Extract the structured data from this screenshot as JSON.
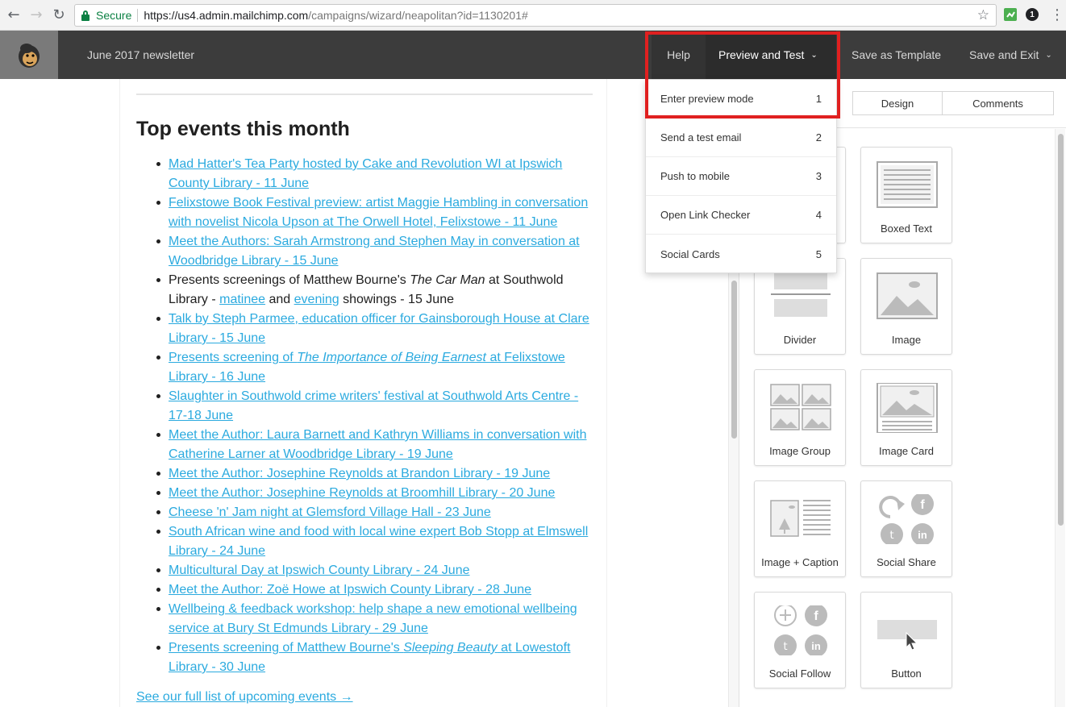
{
  "browser": {
    "secure_label": "Secure",
    "url_host": "https://us4.admin.mailchimp.com",
    "url_path": "/campaigns/wizard/neapolitan?id=1130201#",
    "extension_badge": "1"
  },
  "header": {
    "campaign_title": "June 2017 newsletter",
    "help_label": "Help",
    "preview_label": "Preview and Test",
    "save_template_label": "Save as Template",
    "save_exit_label": "Save and Exit"
  },
  "preview_menu": {
    "items": [
      {
        "label": "Enter preview mode",
        "shortcut": "1"
      },
      {
        "label": "Send a test email",
        "shortcut": "2"
      },
      {
        "label": "Push to mobile",
        "shortcut": "3"
      },
      {
        "label": "Open Link Checker",
        "shortcut": "4"
      },
      {
        "label": "Social Cards",
        "shortcut": "5"
      }
    ]
  },
  "email": {
    "heading": "Top events this month",
    "events": [
      {
        "parts": [
          {
            "t": "Mad Hatter's Tea Party hosted by Cake and Revolution WI at Ipswich County Library - 11 June",
            "link": true
          }
        ]
      },
      {
        "parts": [
          {
            "t": "Felixstowe Book Festival preview: artist Maggie Hambling in conversation with novelist Nicola Upson at The Orwell Hotel, Felixstowe - 11 June",
            "link": true
          }
        ]
      },
      {
        "parts": [
          {
            "t": "Meet the Authors: Sarah Armstrong and Stephen May in conversation at Woodbridge Library - 15 June",
            "link": true
          }
        ]
      },
      {
        "parts": [
          {
            "t": "Presents screenings of Matthew Bourne's "
          },
          {
            "t": "The Car Man",
            "italic": true
          },
          {
            "t": " at Southwold Library - "
          },
          {
            "t": "matinee",
            "link": true
          },
          {
            "t": " and "
          },
          {
            "t": "evening",
            "link": true
          },
          {
            "t": " showings - 15 June"
          }
        ]
      },
      {
        "parts": [
          {
            "t": "Talk by Steph Parmee, education officer for Gainsborough House at Clare Library - 15 June",
            "link": true
          }
        ]
      },
      {
        "parts": [
          {
            "t": "Presents screening of ",
            "link": true
          },
          {
            "t": "The Importance of Being Earnest",
            "link": true,
            "italic": true
          },
          {
            "t": " at Felixstowe Library - 16 June",
            "link": true
          }
        ]
      },
      {
        "parts": [
          {
            "t": "Slaughter in Southwold crime writers' festival at Southwold Arts Centre - 17-18 June",
            "link": true
          }
        ]
      },
      {
        "parts": [
          {
            "t": "Meet the Author: Laura Barnett and Kathryn Williams in conversation with Catherine Larner at Woodbridge Library - 19 June",
            "link": true
          }
        ]
      },
      {
        "parts": [
          {
            "t": "Meet the Author: Josephine Reynolds at Brandon Library - 19 June",
            "link": true
          }
        ]
      },
      {
        "parts": [
          {
            "t": "Meet the Author: Josephine Reynolds at Broomhill Library - 20 June",
            "link": true
          }
        ]
      },
      {
        "parts": [
          {
            "t": "Cheese 'n' Jam night at Glemsford Village Hall - 23 June",
            "link": true
          }
        ]
      },
      {
        "parts": [
          {
            "t": "South African wine and food with local wine expert Bob Stopp at Elmswell Library - 24 June",
            "link": true
          }
        ]
      },
      {
        "parts": [
          {
            "t": "Multicultural Day at Ipswich County Library - 24 June",
            "link": true
          }
        ]
      },
      {
        "parts": [
          {
            "t": "Meet the Author: Zoë Howe at Ipswich County Library - 28 June",
            "link": true
          }
        ]
      },
      {
        "parts": [
          {
            "t": "Wellbeing & feedback workshop: help shape a new emotional wellbeing service at Bury St Edmunds Library - 29 June",
            "link": true
          }
        ]
      },
      {
        "parts": [
          {
            "t": "Presents screening of Matthew Bourne's ",
            "link": true
          },
          {
            "t": "Sleeping Beauty",
            "link": true,
            "italic": true
          },
          {
            "t": " at Lowestoft Library - 30 June",
            "link": true
          }
        ]
      }
    ],
    "see_all": "See our full list of upcoming events →"
  },
  "panel": {
    "tabs": [
      {
        "label": "Design"
      },
      {
        "label": "Comments"
      }
    ],
    "blocks": [
      {
        "label": "Boxed Text",
        "icon": "boxed-text-icon"
      },
      {
        "label": "Divider",
        "icon": "divider-icon"
      },
      {
        "label": "Image",
        "icon": "image-icon"
      },
      {
        "label": "Image Group",
        "icon": "image-group-icon"
      },
      {
        "label": "Image Card",
        "icon": "image-card-icon"
      },
      {
        "label": "Image + Caption",
        "icon": "image-caption-icon"
      },
      {
        "label": "Social Share",
        "icon": "social-share-icon"
      },
      {
        "label": "Social Follow",
        "icon": "social-follow-icon"
      },
      {
        "label": "Button",
        "icon": "button-block-icon"
      }
    ]
  },
  "colors": {
    "link": "#2baadf",
    "header_bg": "#3c3c3c",
    "highlight": "#e02020"
  }
}
